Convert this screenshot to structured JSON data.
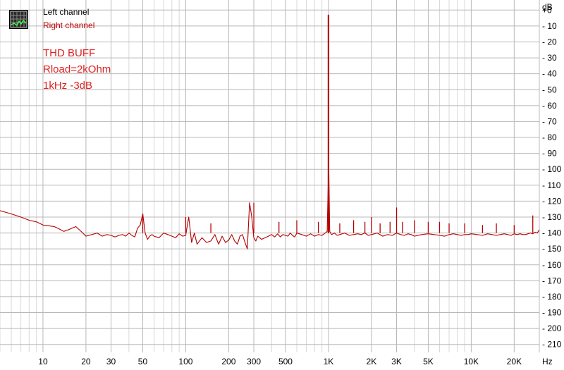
{
  "chart_data": {
    "type": "line",
    "title": "",
    "xlabel": "",
    "ylabel": "",
    "x_unit": "Hz",
    "y_unit": "dB",
    "x_scale": "log",
    "xlim": [
      5,
      30000
    ],
    "ylim": [
      -215,
      5
    ],
    "grid": true,
    "x_ticks": [
      {
        "value": 10,
        "label": "10"
      },
      {
        "value": 20,
        "label": "20"
      },
      {
        "value": 30,
        "label": "30"
      },
      {
        "value": 50,
        "label": "50"
      },
      {
        "value": 100,
        "label": "100"
      },
      {
        "value": 200,
        "label": "200"
      },
      {
        "value": 300,
        "label": "300"
      },
      {
        "value": 500,
        "label": "500"
      },
      {
        "value": 1000,
        "label": "1K"
      },
      {
        "value": 2000,
        "label": "2K"
      },
      {
        "value": 3000,
        "label": "3K"
      },
      {
        "value": 5000,
        "label": "5K"
      },
      {
        "value": 10000,
        "label": "10K"
      },
      {
        "value": 20000,
        "label": "20K"
      }
    ],
    "y_ticks": [
      {
        "value": 0,
        "label": "+0"
      },
      {
        "value": -10,
        "label": "- 10"
      },
      {
        "value": -20,
        "label": "- 20"
      },
      {
        "value": -30,
        "label": "- 30"
      },
      {
        "value": -40,
        "label": "- 40"
      },
      {
        "value": -50,
        "label": "- 50"
      },
      {
        "value": -60,
        "label": "- 60"
      },
      {
        "value": -70,
        "label": "- 70"
      },
      {
        "value": -80,
        "label": "- 80"
      },
      {
        "value": -90,
        "label": "- 90"
      },
      {
        "value": -100,
        "label": "- 100"
      },
      {
        "value": -110,
        "label": "- 110"
      },
      {
        "value": -120,
        "label": "- 120"
      },
      {
        "value": -130,
        "label": "- 130"
      },
      {
        "value": -140,
        "label": "- 140"
      },
      {
        "value": -150,
        "label": "- 150"
      },
      {
        "value": -160,
        "label": "- 160"
      },
      {
        "value": -170,
        "label": "- 170"
      },
      {
        "value": -180,
        "label": "- 180"
      },
      {
        "value": -190,
        "label": "- 190"
      },
      {
        "value": -200,
        "label": "- 200"
      },
      {
        "value": -210,
        "label": "- 210"
      }
    ],
    "legend": {
      "position": "top-left",
      "entries": [
        {
          "label": "Left channel",
          "color": "#000000"
        },
        {
          "label": "Right channel",
          "color": "#c00000"
        }
      ]
    },
    "annotation_lines": [
      "THD BUFF",
      "Rload=2kOhm",
      "1kHz -3dB"
    ],
    "annotation_color": "#e02020",
    "series": [
      {
        "name": "Right channel",
        "color": "#b40000",
        "x": [
          5,
          6,
          7,
          8,
          9,
          10,
          11,
          12,
          13,
          14,
          15,
          16,
          17,
          18,
          19,
          20,
          22,
          24,
          26,
          28,
          30,
          32,
          34,
          36,
          38,
          40,
          42,
          44,
          46,
          48,
          50,
          52,
          54,
          56,
          58,
          60,
          65,
          70,
          75,
          80,
          85,
          90,
          95,
          100,
          105,
          110,
          115,
          120,
          130,
          140,
          150,
          160,
          170,
          180,
          190,
          200,
          210,
          220,
          230,
          240,
          250,
          260,
          270,
          280,
          290,
          300,
          310,
          320,
          340,
          360,
          380,
          400,
          420,
          440,
          460,
          480,
          500,
          520,
          540,
          560,
          580,
          600,
          650,
          700,
          750,
          800,
          850,
          900,
          950,
          980,
          995,
          1000,
          1005,
          1020,
          1050,
          1100,
          1150,
          1200,
          1300,
          1400,
          1500,
          1600,
          1700,
          1800,
          1900,
          2000,
          2200,
          2400,
          2600,
          2800,
          3000,
          3200,
          3400,
          3600,
          3800,
          4000,
          4500,
          5000,
          5500,
          6000,
          6500,
          7000,
          7500,
          8000,
          8500,
          9000,
          9500,
          10000,
          11000,
          12000,
          13000,
          14000,
          15000,
          16000,
          17000,
          18000,
          19000,
          20000,
          21000,
          22000,
          23000,
          24000,
          25000,
          26000,
          27000,
          28000,
          29000,
          30000
        ],
        "y": [
          -126,
          -128,
          -130,
          -132,
          -133,
          -135,
          -135.5,
          -136,
          -137.5,
          -139,
          -138,
          -137,
          -136,
          -138,
          -140,
          -142,
          -141,
          -140,
          -142,
          -141,
          -141.5,
          -142.5,
          -141.5,
          -141,
          -142,
          -140,
          -141.5,
          -142.5,
          -137,
          -135,
          -128,
          -140,
          -144,
          -142,
          -141,
          -142,
          -143,
          -140,
          -141,
          -142,
          -143,
          -140.5,
          -142,
          -141.5,
          -130,
          -146,
          -140,
          -147,
          -143,
          -146,
          -145,
          -141,
          -147,
          -142,
          -146,
          -144.5,
          -141,
          -145,
          -147,
          -142,
          -141,
          -146,
          -150,
          -121,
          -130,
          -143,
          -145,
          -142,
          -144,
          -143,
          -142,
          -141,
          -142.5,
          -140.5,
          -142.5,
          -141,
          -141.5,
          -142,
          -140,
          -141.5,
          -142.5,
          -140,
          -141,
          -142,
          -140.5,
          -142,
          -141,
          -141.5,
          -140,
          -139,
          -110,
          -3,
          -100,
          -139,
          -141,
          -140,
          -141.5,
          -141,
          -140,
          -141.5,
          -141,
          -140.5,
          -141,
          -140,
          -141.5,
          -141,
          -140,
          -142,
          -141,
          -141.5,
          -140,
          -141,
          -141.5,
          -140.5,
          -141,
          -142,
          -141,
          -140.5,
          -141,
          -141.5,
          -142,
          -141,
          -140.5,
          -141,
          -141.5,
          -141,
          -141,
          -140.5,
          -141,
          -141.5,
          -140.5,
          -141,
          -141.5,
          -141,
          -140.5,
          -141,
          -141.5,
          -140.5,
          -141,
          -140.5,
          -141,
          -141,
          -140.5,
          -140,
          -140.5,
          -139.5,
          -140,
          -138
        ]
      }
    ],
    "spikes": [
      {
        "x": 50,
        "y": -128
      },
      {
        "x": 100,
        "y": -130
      },
      {
        "x": 150,
        "y": -134
      },
      {
        "x": 300,
        "y": -121
      },
      {
        "x": 450,
        "y": -133
      },
      {
        "x": 600,
        "y": -132
      },
      {
        "x": 850,
        "y": -133
      },
      {
        "x": 1000,
        "y": -3
      },
      {
        "x": 1200,
        "y": -134
      },
      {
        "x": 1500,
        "y": -132
      },
      {
        "x": 1800,
        "y": -133
      },
      {
        "x": 2000,
        "y": -130
      },
      {
        "x": 2300,
        "y": -134
      },
      {
        "x": 2700,
        "y": -133
      },
      {
        "x": 3000,
        "y": -124
      },
      {
        "x": 3300,
        "y": -133
      },
      {
        "x": 4000,
        "y": -132
      },
      {
        "x": 5000,
        "y": -133
      },
      {
        "x": 6000,
        "y": -133
      },
      {
        "x": 7000,
        "y": -134
      },
      {
        "x": 9000,
        "y": -134
      },
      {
        "x": 12000,
        "y": -135
      },
      {
        "x": 15000,
        "y": -134
      },
      {
        "x": 20000,
        "y": -135
      },
      {
        "x": 27000,
        "y": -129
      }
    ]
  }
}
